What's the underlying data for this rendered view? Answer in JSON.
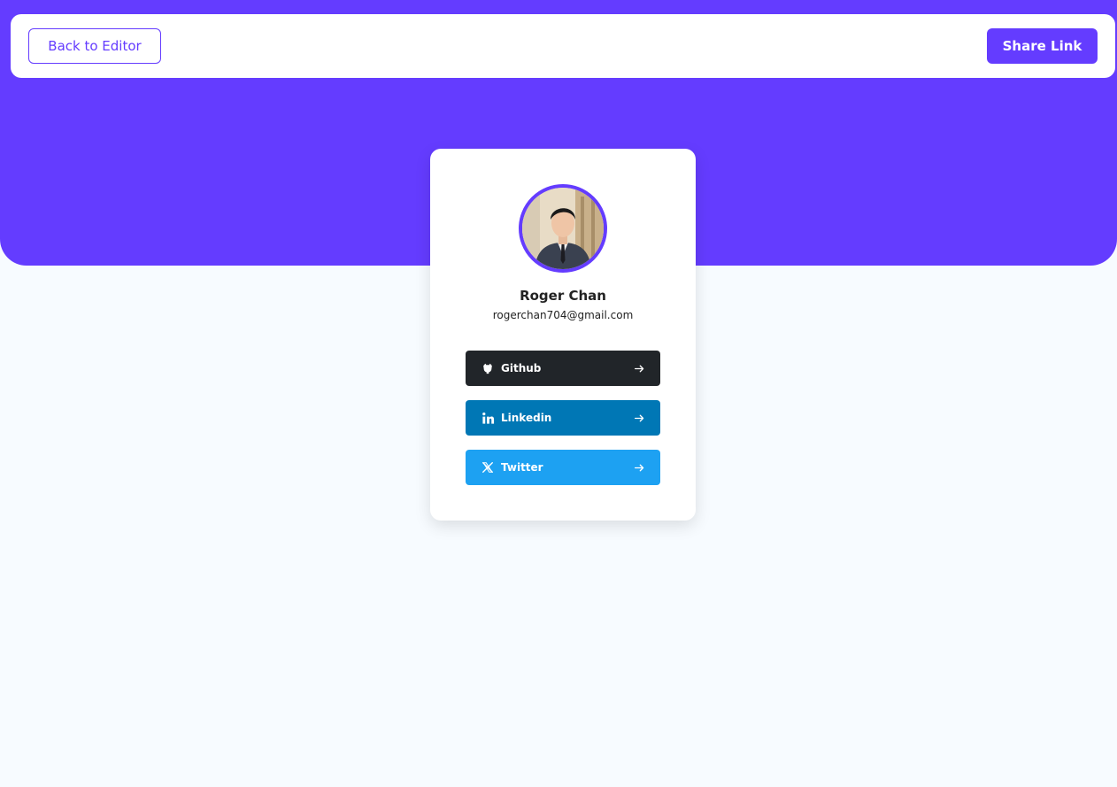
{
  "header": {
    "back_label": "Back to Editor",
    "share_label": "Share Link"
  },
  "profile": {
    "name": "Roger Chan",
    "email": "rogerchan704@gmail.com"
  },
  "links": [
    {
      "label": "Github",
      "icon": "github-icon",
      "color": "#212529"
    },
    {
      "label": "Linkedin",
      "icon": "linkedin-icon",
      "color": "#0077b5"
    },
    {
      "label": "Twitter",
      "icon": "x-twitter-icon",
      "color": "#1da1f2"
    }
  ],
  "colors": {
    "accent": "#643cff",
    "background": "#f7fbff"
  }
}
